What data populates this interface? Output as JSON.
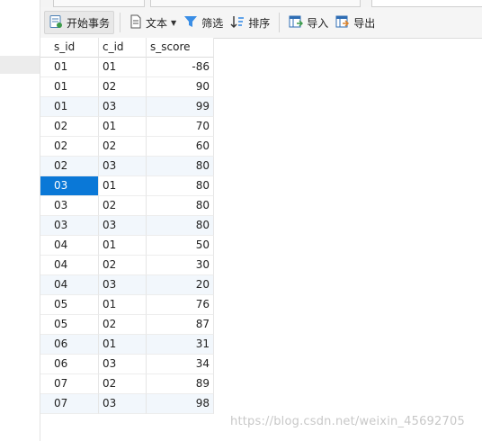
{
  "toolbar": {
    "begin_transaction": "开始事务",
    "text": "文本",
    "filter": "筛选",
    "sort": "排序",
    "import": "导入",
    "export": "导出"
  },
  "columns": [
    "s_id",
    "c_id",
    "s_score"
  ],
  "rows": [
    [
      "01",
      "01",
      "-86"
    ],
    [
      "01",
      "02",
      "90"
    ],
    [
      "01",
      "03",
      "99"
    ],
    [
      "02",
      "01",
      "70"
    ],
    [
      "02",
      "02",
      "60"
    ],
    [
      "02",
      "03",
      "80"
    ],
    [
      "03",
      "01",
      "80"
    ],
    [
      "03",
      "02",
      "80"
    ],
    [
      "03",
      "03",
      "80"
    ],
    [
      "04",
      "01",
      "50"
    ],
    [
      "04",
      "02",
      "30"
    ],
    [
      "04",
      "03",
      "20"
    ],
    [
      "05",
      "01",
      "76"
    ],
    [
      "05",
      "02",
      "87"
    ],
    [
      "06",
      "01",
      "31"
    ],
    [
      "06",
      "03",
      "34"
    ],
    [
      "07",
      "02",
      "89"
    ],
    [
      "07",
      "03",
      "98"
    ]
  ],
  "selected_row": 6,
  "watermark": "https://blog.csdn.net/weixin_45692705",
  "colors": {
    "selection": "#0a78d7",
    "alt_row": "#f2f7fc",
    "filter_icon": "#3a8ee6"
  }
}
